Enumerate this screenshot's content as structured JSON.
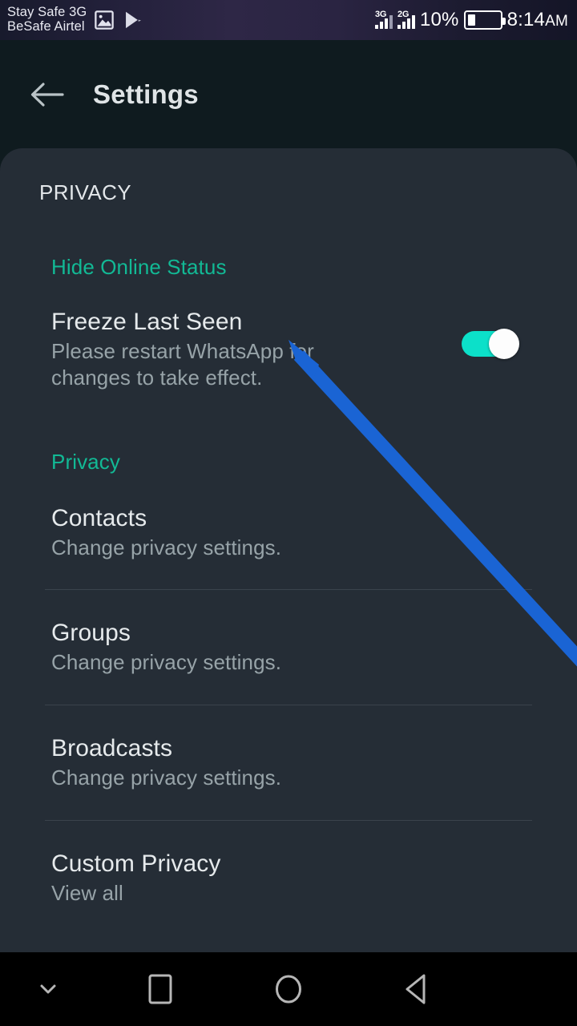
{
  "status_bar": {
    "carrier_line1": "Stay Safe 3G",
    "carrier_line2": "BeSafe Airtel",
    "icons": [
      "image-icon",
      "play-store-icon"
    ],
    "sim1_network": "3G",
    "sim2_network": "2G",
    "battery_percent": "10%",
    "clock_time": "8:14",
    "clock_ampm": "AM"
  },
  "toolbar": {
    "back_icon": "arrow-left-icon",
    "title": "Settings"
  },
  "content": {
    "caption": "PRIVACY",
    "sections": [
      {
        "header": "Hide Online Status",
        "rows": [
          {
            "title": "Freeze Last Seen",
            "subtitle": "Please restart WhatsApp for changes to take effect.",
            "toggle": "on"
          }
        ]
      },
      {
        "header": "Privacy",
        "rows": [
          {
            "title": "Contacts",
            "subtitle": "Change privacy settings."
          },
          {
            "title": "Groups",
            "subtitle": "Change privacy settings."
          },
          {
            "title": "Broadcasts",
            "subtitle": "Change privacy settings."
          },
          {
            "title": "Custom Privacy",
            "subtitle": "View all"
          }
        ]
      }
    ]
  },
  "nav_bar": {
    "hide_icon": "chevron-down-icon",
    "recents_icon": "square-icon",
    "home_icon": "circle-icon",
    "back_icon": "triangle-left-icon"
  },
  "annotation": {
    "type": "arrow",
    "color": "#1a64d4",
    "points_to": "Freeze Last Seen"
  },
  "colors": {
    "accent_teal": "#12b995",
    "toggle_on": "#0ce0c9",
    "panel_bg": "#252d36",
    "toolbar_bg": "#0f1b1f",
    "annotation_blue": "#1a64d4"
  }
}
